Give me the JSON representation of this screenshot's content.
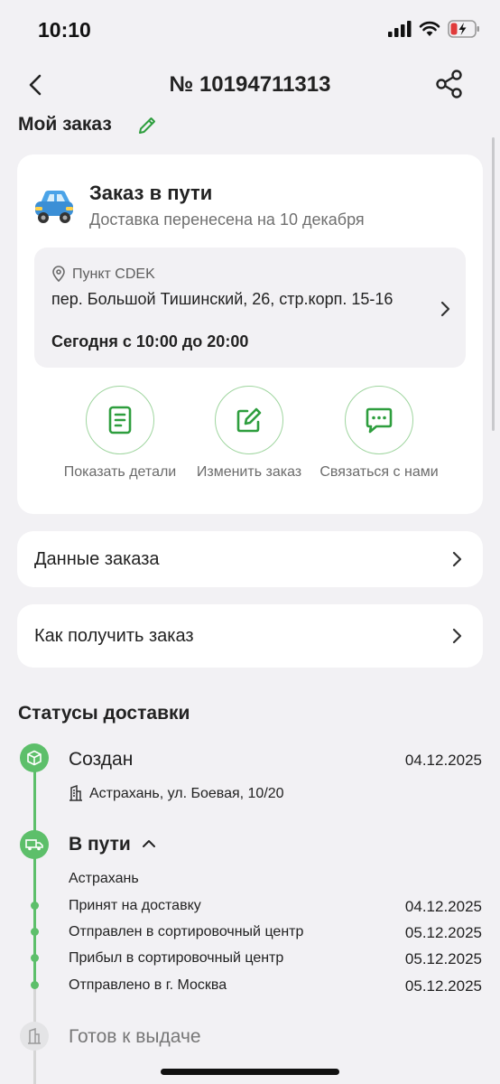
{
  "status_bar": {
    "time": "10:10"
  },
  "header": {
    "order_number": "№ 10194711313"
  },
  "my_order": {
    "title": "Мой заказ"
  },
  "order_card": {
    "status_title": "Заказ в пути",
    "status_subtitle": "Доставка перенесена на 10 декабря",
    "pickup": {
      "type": "Пункт CDEK",
      "address": "пер. Большой Тишинский, 26, стр.корп. 15-16",
      "hours": "Сегодня с 10:00 до 20:00"
    },
    "actions": [
      {
        "label": "Показать детали",
        "icon": "document-icon"
      },
      {
        "label": "Изменить заказ",
        "icon": "pencil-icon"
      },
      {
        "label": "Связаться с нами",
        "icon": "chat-icon"
      }
    ]
  },
  "rows": {
    "order_data": "Данные заказа",
    "how_to_receive": "Как получить заказ"
  },
  "delivery_statuses": {
    "title": "Статусы доставки",
    "created": {
      "title": "Создан",
      "date": "04.12.2025",
      "address": "Астрахань, ул. Боевая, 10/20"
    },
    "in_transit": {
      "title": "В пути",
      "city": "Астрахань",
      "events": [
        {
          "text": "Принят на доставку",
          "date": "04.12.2025"
        },
        {
          "text": "Отправлен в сортировочный центр",
          "date": "05.12.2025"
        },
        {
          "text": "Прибыл в сортировочный центр",
          "date": "05.12.2025"
        },
        {
          "text": "Отправлено в г. Москва",
          "date": "05.12.2025"
        }
      ]
    },
    "ready": {
      "title": "Готов к выдаче"
    }
  },
  "colors": {
    "accent_green": "#2e9e3e",
    "timeline_green": "#5dbf6a",
    "background": "#f2f1f4"
  }
}
